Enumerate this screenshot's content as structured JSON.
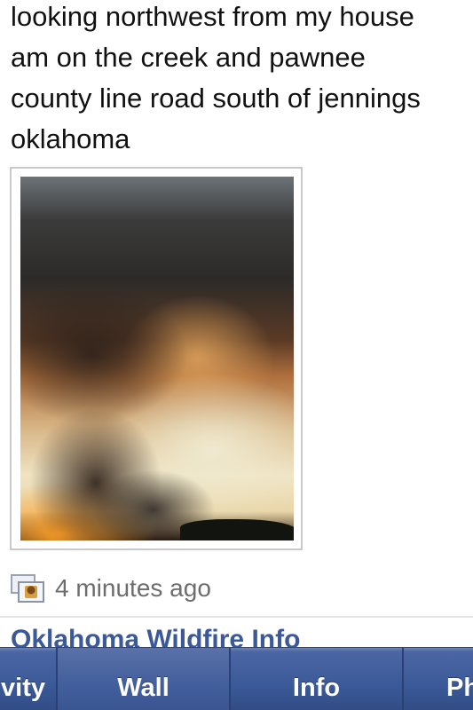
{
  "post": {
    "text": "looking northwest from my house\nam on the creek and pawnee\ncounty line road south of jennings\noklahoma"
  },
  "photo": {
    "description": "smoke plume from wildfire"
  },
  "meta": {
    "timestamp": "4 minutes ago",
    "icon": "photo-album-icon"
  },
  "next_post": {
    "title": "Oklahoma Wildfire Info"
  },
  "tabs": [
    {
      "label": "Activity"
    },
    {
      "label": "Wall"
    },
    {
      "label": "Info"
    },
    {
      "label": "Photos"
    }
  ],
  "colors": {
    "tabbar": "#3b5998",
    "link": "#3b5998",
    "timestamp": "#6d6d6d"
  }
}
